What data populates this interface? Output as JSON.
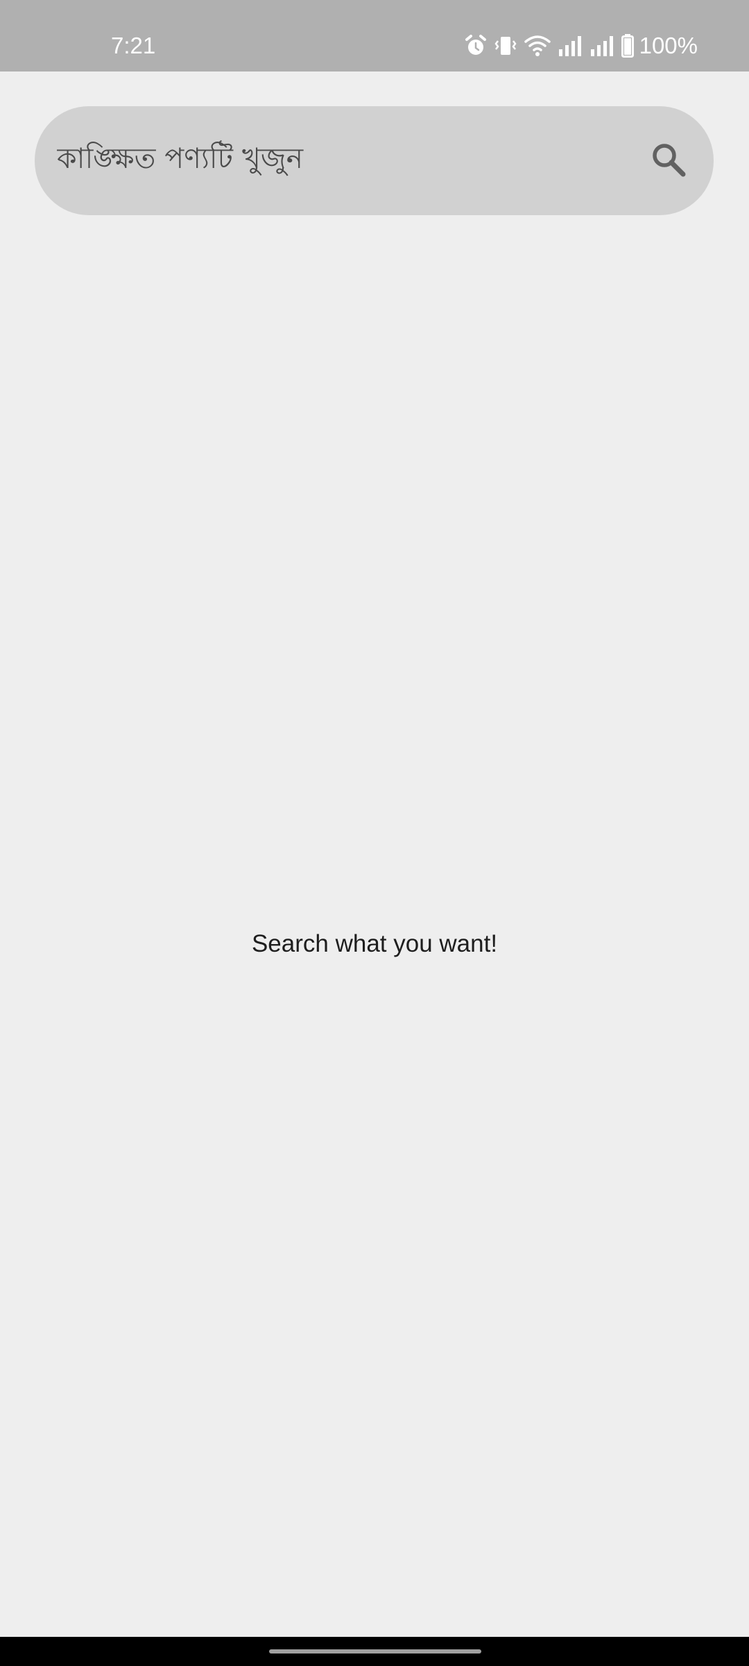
{
  "status_bar": {
    "time": "7:21",
    "battery_percent": "100%",
    "icons": [
      "alarm-icon",
      "vibrate-icon",
      "wifi-icon",
      "signal-icon",
      "signal-icon",
      "battery-icon"
    ]
  },
  "search": {
    "placeholder": "কাঙ্ক্ষিত পণ্যটি খুজুন",
    "value": "",
    "button_icon": "search-icon"
  },
  "main": {
    "empty_message": "Search what you want!"
  },
  "colors": {
    "status_bar": "#b0b0b0",
    "background": "#eeeeee",
    "search_bar": "#d1d1d1",
    "search_icon": "#616161",
    "nav_bar": "#000000"
  }
}
